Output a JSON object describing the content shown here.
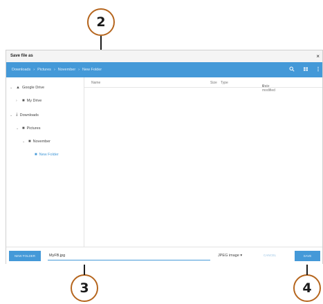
{
  "callouts": {
    "c2": "2",
    "c3": "3",
    "c4": "4"
  },
  "dialog": {
    "title": "Save file as",
    "close_glyph": "×",
    "breadcrumbs": [
      "Downloads",
      "Pictures",
      "November",
      "New Folder"
    ],
    "crumb_separator": "›",
    "toolbar_icons": [
      "search-icon",
      "grid-view-icon",
      "more-vert-icon"
    ]
  },
  "sidebar": {
    "items": [
      {
        "label": "Google Drive",
        "icon": "drive-icon",
        "expanded": true
      },
      {
        "label": "My Drive",
        "icon": "folder-icon",
        "expanded": false
      },
      {
        "label": "Downloads",
        "icon": "download-icon",
        "expanded": true
      },
      {
        "label": "Pictures",
        "icon": "folder-icon",
        "expanded": true
      },
      {
        "label": "November",
        "icon": "folder-icon",
        "expanded": true
      },
      {
        "label": "New Folder",
        "icon": "folder-icon",
        "selected": true
      }
    ]
  },
  "list": {
    "columns": [
      "Name",
      "Size",
      "Type",
      "Date modified"
    ],
    "sort_indicator": "▾"
  },
  "footer": {
    "new_folder_label": "NEW FOLDER",
    "filename_value": "MyFB.jpg",
    "file_type": "JPEG image",
    "file_type_arrow": "▾",
    "cancel_label": "CANCEL",
    "save_label": "SAVE"
  },
  "colors": {
    "accent": "#4499d8",
    "callout_border": "#b5651d"
  }
}
